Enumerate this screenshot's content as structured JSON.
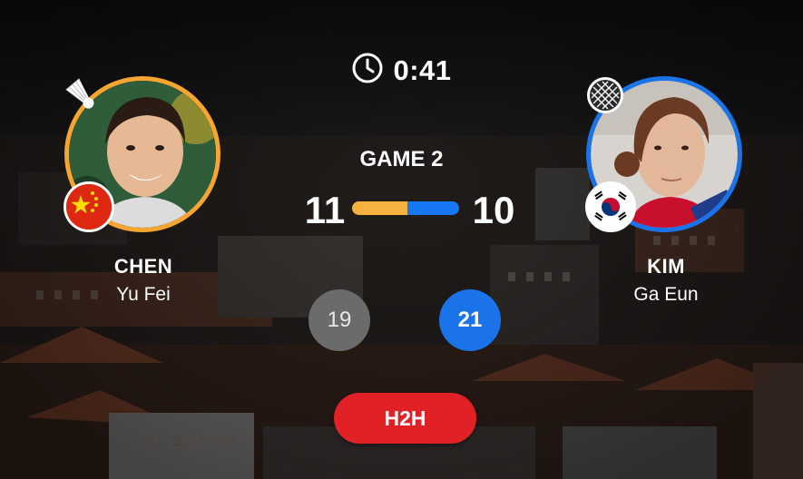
{
  "match": {
    "elapsed_time": "0:41",
    "game_label": "GAME 2",
    "current_game": {
      "left_points": "11",
      "right_points": "10",
      "progress_left_fraction": 0.52
    }
  },
  "player_left": {
    "last_name": "CHEN",
    "first_name": "Yu Fei",
    "country_flag": "china-flag",
    "serve_indicator": "shuttlecock-icon",
    "ring_color": "#f6a531",
    "games_score": "19",
    "games_color": "#6b6b6b"
  },
  "player_right": {
    "last_name": "KIM",
    "first_name": "Ga Eun",
    "country_flag": "south-korea-flag",
    "indicator": "racket-icon",
    "ring_color": "#1a73e8",
    "games_score": "21",
    "games_color": "#1a73e8"
  },
  "actions": {
    "h2h_label": "H2H",
    "h2h_color": "#e02126"
  }
}
